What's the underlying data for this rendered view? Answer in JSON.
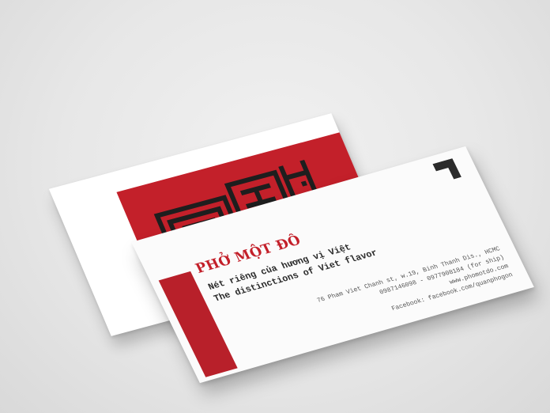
{
  "scene": {
    "background_color": "#e9e9e9",
    "brand_red": "#c3202a"
  },
  "back_card": {
    "logo_icon": "pho-mot-do-logo-icon"
  },
  "front_card": {
    "brand_name": "PHỞ MỘT ĐÔ",
    "tagline_vi": "Nét riêng của hương vị Việt",
    "tagline_en": "The distinctions of Viet flavor",
    "address": "76 Pham Viet Chanh st, w.19, Binh Thanh Dis., HCMC",
    "phones": "0987146098 - 0977908184 (for ship)",
    "website": "www.phomotdo.com",
    "facebook": "Facebook: facebook.com/quanphogon",
    "corner_icon": "corner-bracket-icon"
  }
}
